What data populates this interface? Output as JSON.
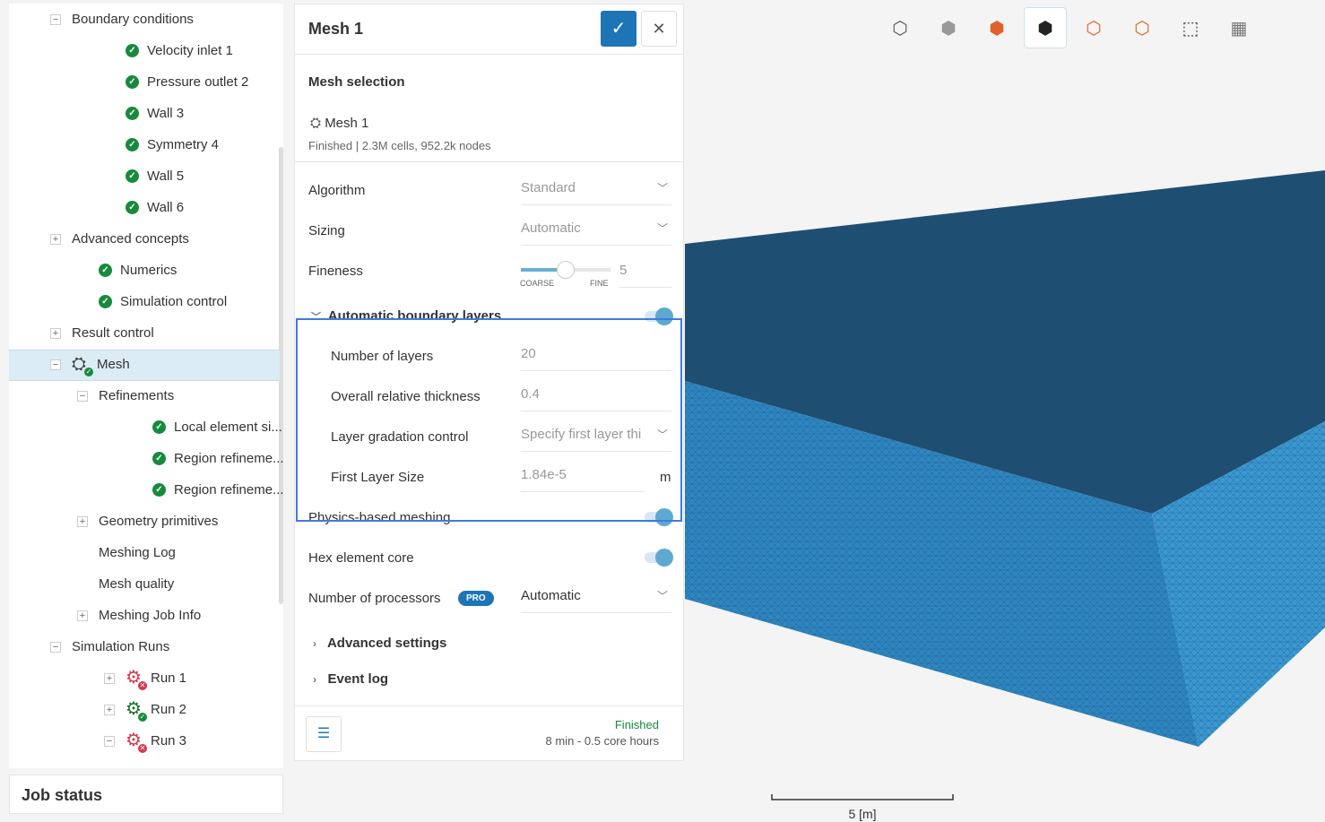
{
  "tree": {
    "items": [
      {
        "label": "Boundary conditions",
        "pm": "−",
        "level": 0,
        "icon": "none"
      },
      {
        "label": "Velocity inlet 1",
        "level": 2,
        "icon": "check"
      },
      {
        "label": "Pressure outlet 2",
        "level": 2,
        "icon": "check"
      },
      {
        "label": "Wall 3",
        "level": 2,
        "icon": "check"
      },
      {
        "label": "Symmetry 4",
        "level": 2,
        "icon": "check"
      },
      {
        "label": "Wall 5",
        "level": 2,
        "icon": "check"
      },
      {
        "label": "Wall 6",
        "level": 2,
        "icon": "check"
      },
      {
        "label": "Advanced concepts",
        "pm": "+",
        "level": 0,
        "icon": "none"
      },
      {
        "label": "Numerics",
        "level": 1,
        "icon": "check"
      },
      {
        "label": "Simulation control",
        "level": 1,
        "icon": "check"
      },
      {
        "label": "Result control",
        "pm": "+",
        "level": 0,
        "icon": "none"
      },
      {
        "label": "Mesh",
        "pm": "−",
        "level": 0,
        "icon": "mesh",
        "selected": true
      },
      {
        "label": "Refinements",
        "pm": "−",
        "level": 1,
        "icon": "none"
      },
      {
        "label": "Local element si...",
        "level": 3,
        "icon": "check"
      },
      {
        "label": "Region refineme...",
        "level": 3,
        "icon": "check"
      },
      {
        "label": "Region refineme...",
        "level": 3,
        "icon": "check"
      },
      {
        "label": "Geometry primitives",
        "pm": "+",
        "level": 1,
        "icon": "none"
      },
      {
        "label": "Meshing Log",
        "level": 1,
        "icon": "none"
      },
      {
        "label": "Mesh quality",
        "level": 1,
        "icon": "none"
      },
      {
        "label": "Meshing Job Info",
        "pm": "+",
        "level": 1,
        "icon": "none"
      },
      {
        "label": "Simulation Runs",
        "pm": "−",
        "level": 0,
        "icon": "none"
      },
      {
        "label": "Run 1",
        "pm": "+",
        "level": 2,
        "icon": "gear-fail"
      },
      {
        "label": "Run 2",
        "pm": "+",
        "level": 2,
        "icon": "gear-ok"
      },
      {
        "label": "Run 3",
        "pm": "−",
        "level": 2,
        "icon": "gear-fail"
      }
    ],
    "job_status": "Job status"
  },
  "panel": {
    "title": "Mesh 1",
    "section": "Mesh selection",
    "mesh_name": "Mesh 1",
    "mesh_info": "Finished | 2.3M cells, 952.2k nodes",
    "algorithm_label": "Algorithm",
    "algorithm_value": "Standard",
    "sizing_label": "Sizing",
    "sizing_value": "Automatic",
    "fineness_label": "Fineness",
    "fineness_value": "5",
    "fineness_fraction": 0.5,
    "coarse": "COARSE",
    "fine": "FINE",
    "abl_label": "Automatic boundary layers",
    "abl_on": true,
    "layers_label": "Number of layers",
    "layers_value": "20",
    "thickness_label": "Overall relative thickness",
    "thickness_value": "0.4",
    "gradation_label": "Layer gradation control",
    "gradation_value": "Specify first layer thi",
    "first_label": "First Layer Size",
    "first_value": "1.84e-5",
    "first_unit": "m",
    "physics_label": "Physics-based meshing",
    "physics_on": true,
    "hex_label": "Hex element core",
    "hex_on": true,
    "proc_label": "Number of processors",
    "pro_badge": "PRO",
    "proc_value": "Automatic",
    "advanced": "Advanced settings",
    "eventlog": "Event log",
    "status": "Finished",
    "status_detail": "8 min - 0.5 core hours",
    "colors": {
      "accent": "#1d74b6",
      "finished": "#178a3d",
      "highlight": "#3b7ddd"
    }
  },
  "viewer": {
    "scale_label": "5 [m]",
    "mesh_color": "#2e86c1"
  }
}
